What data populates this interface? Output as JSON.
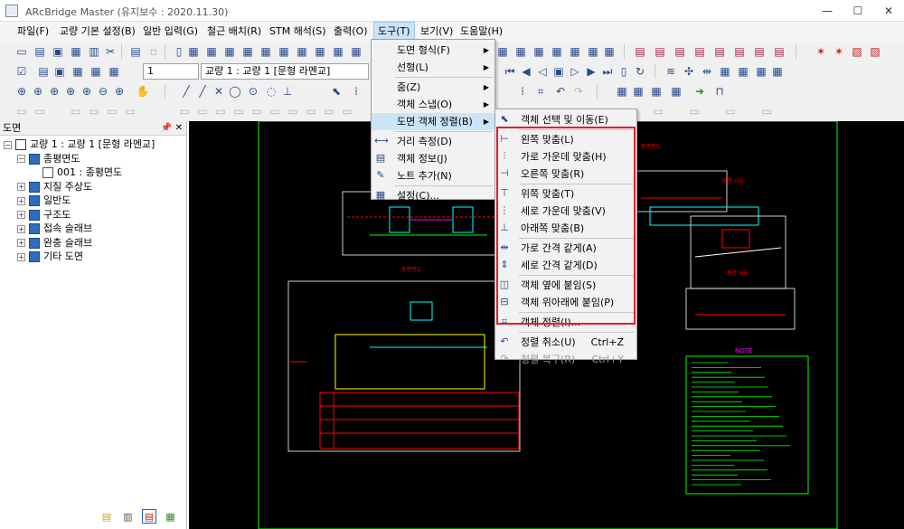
{
  "window": {
    "title": "ARcBridge Master  (유지보수 : 2020.11.30)"
  },
  "menubar": {
    "items": [
      "파일(F)",
      "교량 기본 설정(B)",
      "일반 입력(G)",
      "철근 배치(R)",
      "STM 해석(S)",
      "출력(O)",
      "도구(T)",
      "보기(V)",
      "도움말(H)"
    ]
  },
  "toolbar2": {
    "page_number": "1",
    "bridge_select": "교량 1 : 교량 1 [문형 라멘교]"
  },
  "left_panel": {
    "title": "도면",
    "tree": [
      {
        "label": "교량 1 : 교량 1 [문형 라멘교]",
        "level": 0,
        "expander": "−"
      },
      {
        "label": "종평면도",
        "level": 1,
        "expander": "−"
      },
      {
        "label": "001 : 종평면도",
        "level": 2,
        "expander": ""
      },
      {
        "label": "지질 주상도",
        "level": 1,
        "expander": "+"
      },
      {
        "label": "일반도",
        "level": 1,
        "expander": "+"
      },
      {
        "label": "구조도",
        "level": 1,
        "expander": "+"
      },
      {
        "label": "접속 슬래브",
        "level": 1,
        "expander": "+"
      },
      {
        "label": "완충 슬래브",
        "level": 1,
        "expander": "+"
      },
      {
        "label": "기타 도면",
        "level": 1,
        "expander": "+"
      }
    ]
  },
  "tools_menu": {
    "items": [
      {
        "label": "도면 형식(F)",
        "submenu": true
      },
      {
        "label": "선형(L)",
        "submenu": true
      },
      {
        "separator": true
      },
      {
        "label": "줌(Z)",
        "submenu": true
      },
      {
        "label": "객체 스냅(O)",
        "submenu": true
      },
      {
        "label": "도면 객체 정렬(B)",
        "submenu": true,
        "highlighted": true
      },
      {
        "separator": true
      },
      {
        "label": "거리 측정(D)",
        "icon": "ruler-icon"
      },
      {
        "label": "객체 정보(J)",
        "icon": "info-icon"
      },
      {
        "label": "노트 추가(N)",
        "icon": "note-icon"
      },
      {
        "separator": true
      },
      {
        "label": "설정(C)...",
        "icon": "settings-icon"
      }
    ]
  },
  "align_submenu": {
    "items": [
      {
        "label": "객체 선택 및 이동(E)",
        "icon": "select-move-icon"
      },
      {
        "separator": true
      },
      {
        "label": "왼쪽 맞춤(L)",
        "icon": "align-left-icon"
      },
      {
        "label": "가로 가운데 맞춤(H)",
        "icon": "align-hcenter-icon"
      },
      {
        "label": "오른쪽 맞춤(R)",
        "icon": "align-right-icon"
      },
      {
        "separator": true
      },
      {
        "label": "위쪽 맞춤(T)",
        "icon": "align-top-icon"
      },
      {
        "label": "세로 가운데 맞춤(V)",
        "icon": "align-vcenter-icon"
      },
      {
        "label": "아래쪽 맞춤(B)",
        "icon": "align-bottom-icon"
      },
      {
        "separator": true
      },
      {
        "label": "가로 간격 같게(A)",
        "icon": "hspace-equal-icon"
      },
      {
        "label": "세로 간격 같게(D)",
        "icon": "vspace-equal-icon"
      },
      {
        "separator": true
      },
      {
        "label": "객체 옆에 붙임(S)",
        "icon": "attach-side-icon"
      },
      {
        "label": "객체 위아래에 붙임(P)",
        "icon": "attach-vertical-icon"
      },
      {
        "separator": true
      },
      {
        "label": "객체 정렬(I)...",
        "icon": "arrange-icon"
      },
      {
        "separator": true
      },
      {
        "label": "정렬 취소(U)",
        "icon": "undo-icon",
        "shortcut": "Ctrl+Z"
      },
      {
        "label": "정렬 복구(R)",
        "icon": "redo-icon",
        "shortcut": "Ctrl+Y",
        "disabled": true
      }
    ]
  },
  "drawing": {
    "label_front_view": "종평면도",
    "label_front_view2": "종평면도",
    "label_section_a": "정면 시도",
    "label_section_b": "평면 사도",
    "note_title": "NOTE"
  },
  "colors": {
    "highlight_box": "#e0202a",
    "menu_highlight": "#cce4f7",
    "canvas_bg": "#000000",
    "drawing_green": "#00ff00",
    "drawing_red": "#ff0000",
    "drawing_cyan": "#00ffff",
    "drawing_magenta": "#ff00ff",
    "drawing_yellow": "#ffff00"
  }
}
